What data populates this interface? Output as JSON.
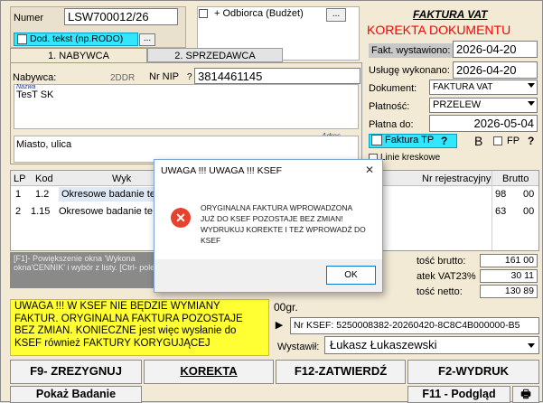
{
  "header": {
    "numer_label": "Numer",
    "numer_value": "LSW700012/26",
    "odbiorca_checkbox_label": "+ Odbiorca (Budżet)",
    "odbiorca_dots": "...",
    "dod_tekst_label": "Dod. tekst (np.RODO)",
    "dod_tekst_dots": "...",
    "doc_title": "FAKTURA VAT",
    "doc_subtitle": "KOREKTA DOKUMENTU"
  },
  "tabs": {
    "tab1": "1. NABYWCA",
    "tab2": "2. SPRZEDAWCA"
  },
  "buyer": {
    "nabywca_label": "Nabywca:",
    "ddr_label": "2DDR",
    "nip_label": "Nr NIP",
    "nip_q": "?",
    "nip_value": "3814461145",
    "nazwa_hint": "Nazwa",
    "name_value": "TesT SK",
    "adres_hint": "Adres",
    "address_value": "Miasto, ulica"
  },
  "right_panel": {
    "fakt_wyst_label": "Fakt. wystawiono:",
    "fakt_wyst_value": "2026-04-20",
    "usluge_label": "Usługę wykonano:",
    "usluge_value": "2026-04-20",
    "dokument_label": "Dokument:",
    "dokument_value": "FAKTURA VAT",
    "platnosc_label": "Płatność:",
    "platnosc_value": "PRZELEW",
    "platna_do_label": "Płatna do:",
    "platna_do_value": "2026-05-04",
    "faktura_tp_label": "Faktura TP",
    "faktura_tp_q": "?",
    "b_label": "B",
    "fp_label": "FP",
    "fp_q": "?",
    "linie_label": "Linie kreskowe"
  },
  "table": {
    "headers": {
      "lp": "LP",
      "kod": "Kod",
      "wyk": "Wyk",
      "nr_rej": "Nr rejestracyjny",
      "brutto": "Brutto"
    },
    "rows": [
      {
        "lp": "1",
        "kod": "1.2",
        "name": "Okresowe badanie te",
        "zl": "98",
        "gr": "00"
      },
      {
        "lp": "2",
        "kod": "1.15",
        "name": "Okresowe badanie te",
        "zl": "63",
        "gr": "00"
      }
    ]
  },
  "help_text": "[F1]- Powiększenie okna 'Wykona okna'CENNIK' i wybór z listy. [Ctrl- pole",
  "totals": {
    "brutto_label": "tość brutto:",
    "brutto_value": "161 00",
    "vat_label": "atek VAT23%",
    "vat_value": "30 11",
    "netto_label": "tość netto:",
    "netto_value": "130 89"
  },
  "warning_text": "UWAGA !!!   W KSEF NIE BĘDZIE WYMIANY FAKTUR.   ORYGINALNA FAKTURA POZOSTAJE BEZ ZMIAN. KONIECZNE jest więc wysłanie do KSEF również FAKTURY KORYGUJĄCEJ",
  "slownie": "00gr.",
  "ksef_arrow": "▶",
  "ksef_label": "Nr KSEF: 5250008382-20260420-8C8C4B000000-B5",
  "wystawil_label": "Wystawił:",
  "wystawil_value": "Łukasz Łukaszewski",
  "buttons": {
    "f9": "F9- ZREZYGNUJ",
    "korekta": "KOREKTA",
    "f12": "F12-ZATWIERDŹ",
    "f2": "F2-WYDRUK",
    "pokaz": "Pokaż Badanie",
    "f11": "F11 - Podgląd",
    "print_icon": "🖶"
  },
  "dialog": {
    "title": "UWAGA !!!  UWAGA !!! KSEF",
    "close": "✕",
    "line1": "ORYGINALNA FAKTURA WPROWADZONA",
    "line2": "JUŻ DO KSEF POZOSTAJE BEZ ZMIAN!",
    "line3": "WYDRUKUJ KOREKTE I TEŻ WPROWADŹ DO KSEF",
    "ok": "OK"
  },
  "colors": {
    "warning_bg": "#ffff33",
    "title_red": "#ff0000",
    "cyan": "#33e6ff",
    "error": "#e8412c"
  }
}
